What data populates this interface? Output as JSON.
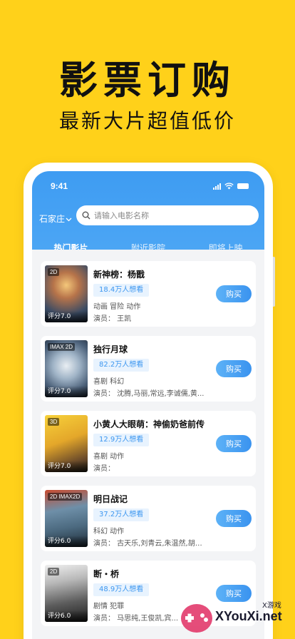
{
  "promo": {
    "title": "影票订购",
    "subtitle": "最新大片超值低价"
  },
  "status": {
    "time": "9:41"
  },
  "header": {
    "city": "石家庄",
    "search_placeholder": "请输入电影名称",
    "tabs": [
      {
        "label": "热门影片",
        "active": true
      },
      {
        "label": "附近影院",
        "active": false
      },
      {
        "label": "即将上映",
        "active": false
      }
    ]
  },
  "movies": [
    {
      "title": "新神榜：杨戬",
      "badge": "2D",
      "score": "评分7.0",
      "want": "18.4万人想看",
      "genre": "动画 冒险 动作",
      "actors": "演员： 王凯",
      "buy": "购买"
    },
    {
      "title": "独行月球",
      "badge": "IMAX 2D",
      "score": "评分7.0",
      "want": "82.2万人想看",
      "genre": "喜剧 科幻",
      "actors": "演员： 沈腾,马丽,常远,李诚儒,黄...",
      "buy": "购买"
    },
    {
      "title": "小黄人大眼萌：神偷奶爸前传",
      "badge": "3D",
      "score": "评分7.0",
      "want": "12.9万人想看",
      "genre": "喜剧 动作",
      "actors": "演员：",
      "buy": "购买"
    },
    {
      "title": "明日战记",
      "badge": "2D IMAX2D",
      "score": "评分6.0",
      "want": "37.2万人想看",
      "genre": "科幻 动作",
      "actors": "演员： 古天乐,刘青云,朱温然,胡子...",
      "buy": "购买"
    },
    {
      "title": "断・桥",
      "badge": "2D",
      "score": "评分6.0",
      "want": "48.9万人想看",
      "genre": "剧情 犯罪",
      "actors": "演员： 马思纯,王俊凯,宾...",
      "buy": "购买"
    }
  ],
  "watermark": {
    "main": "XYouXi.net",
    "small": "X游戏"
  },
  "colors": {
    "background": "#FFD11A",
    "accent": "#3D97F0"
  }
}
